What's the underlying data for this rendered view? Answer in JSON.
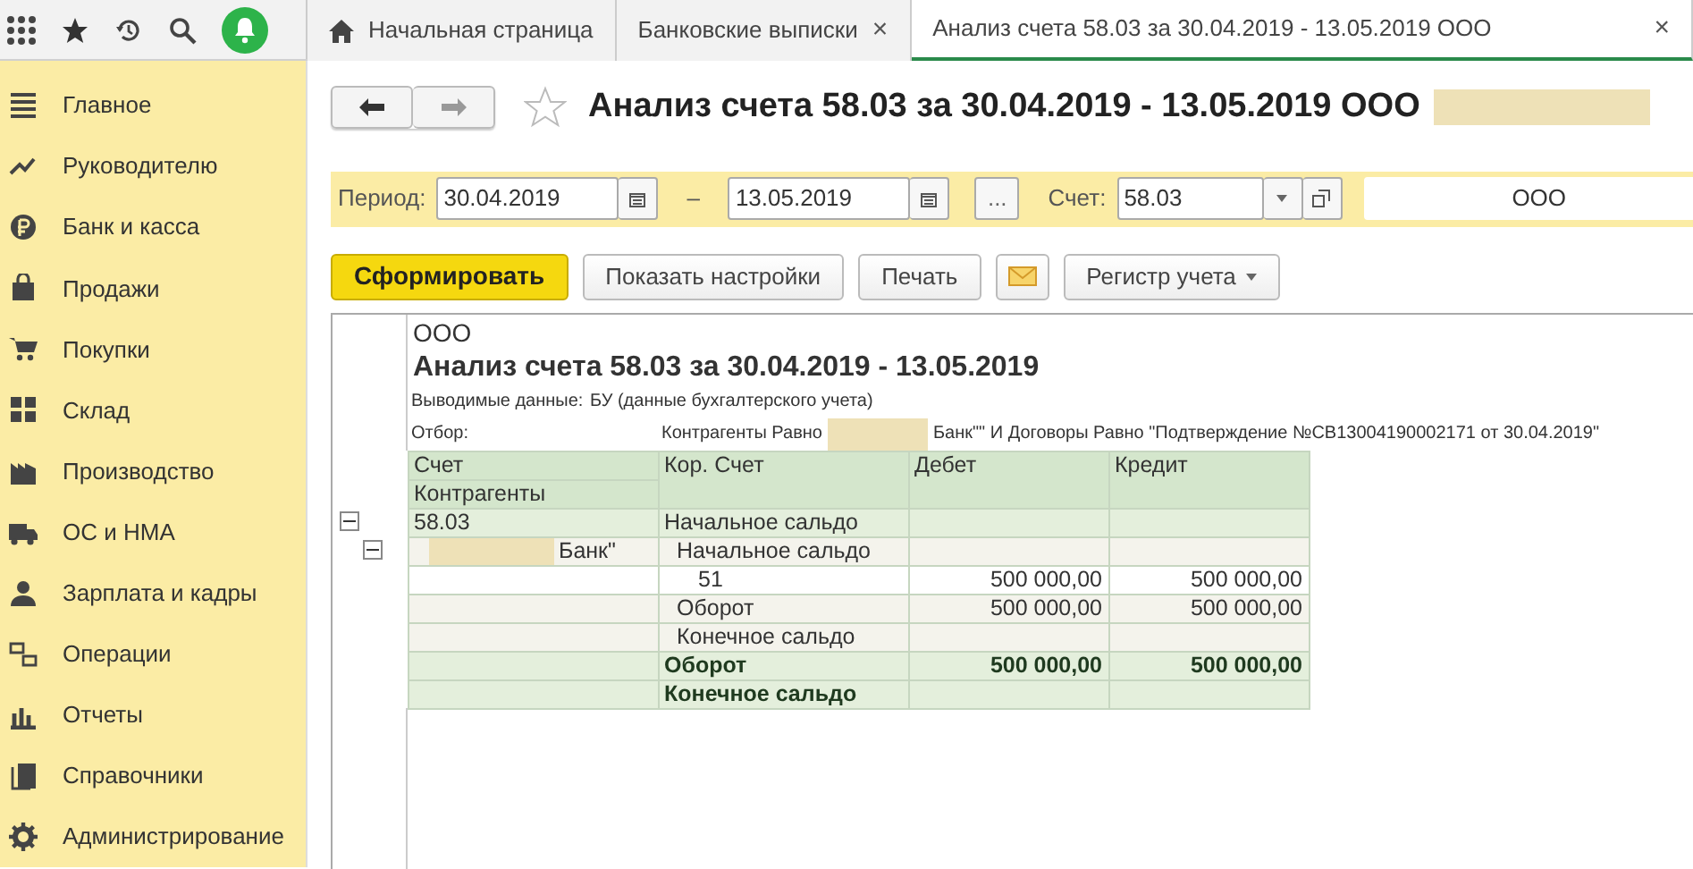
{
  "tabs": [
    {
      "label": "Начальная страница",
      "kind": "home",
      "selected": false
    },
    {
      "label": "Банковские выписки",
      "kind": "closable",
      "selected": false
    },
    {
      "label": "Анализ счета 58.03 за 30.04.2019 - 13.05.2019 ООО",
      "kind": "closable",
      "selected": true
    }
  ],
  "close_glyph": "×",
  "sidebar": {
    "items": [
      {
        "label": "Главное"
      },
      {
        "label": "Руководителю"
      },
      {
        "label": "Банк и касса"
      },
      {
        "label": "Продажи"
      },
      {
        "label": "Покупки"
      },
      {
        "label": "Склад"
      },
      {
        "label": "Производство"
      },
      {
        "label": "ОС и НМА"
      },
      {
        "label": "Зарплата и кадры"
      },
      {
        "label": "Операции"
      },
      {
        "label": "Отчеты"
      },
      {
        "label": "Справочники"
      },
      {
        "label": "Администрирование"
      }
    ]
  },
  "form": {
    "title": "Анализ счета 58.03 за 30.04.2019 - 13.05.2019 ООО",
    "title_redacted": true,
    "favorite": false,
    "period_label": "Период:",
    "date_from": "30.04.2019",
    "dash": "–",
    "date_to": "13.05.2019",
    "more": "...",
    "account_label": "Счет:",
    "account": "58.03",
    "org": "ООО",
    "buttons": [
      {
        "label": "Сформировать",
        "kind": "primary"
      },
      {
        "label": "Показать настройки",
        "kind": "plain"
      },
      {
        "label": "Печать",
        "kind": "plain"
      },
      {
        "kind": "mail"
      },
      {
        "label": "Регистр учета",
        "kind": "dropdown"
      }
    ]
  },
  "report": {
    "org": "ООО",
    "title": "Анализ счета 58.03 за 30.04.2019 - 13.05.2019",
    "params": [
      {
        "name": "Выводимые данные:",
        "value": "БУ (данные бухгалтерского учета)"
      },
      {
        "name": "Отбор:",
        "value": "Контрагенты Равно",
        "redacted": true,
        "value_after": "Банк\"\" И Договоры Равно \"Подтверждение №СВ13004190002171 от 30.04.2019\""
      }
    ],
    "columns": {
      "account": "Счет",
      "counterparty": "Контрагенты",
      "corr": "Кор. Счет",
      "debit": "Дебет",
      "credit": "Кредит"
    },
    "rows": [
      {
        "kind": "group",
        "account": "58.03",
        "corr": "Начальное сальдо",
        "expanded": true,
        "children": [
          {
            "kind": "subgroup",
            "account": "Банк\"",
            "redacted": true,
            "corr": "Начальное сальдо",
            "expanded": true,
            "children": [
              {
                "kind": "detail",
                "corr": "51",
                "debit": "500 000,00",
                "credit": "500 000,00"
              },
              {
                "kind": "sub",
                "corr": "Оборот",
                "debit": "500 000,00",
                "credit": "500 000,00"
              },
              {
                "kind": "sub",
                "corr": "Конечное сальдо"
              }
            ]
          }
        ]
      },
      {
        "kind": "total",
        "corr": "Оборот",
        "debit": "500 000,00",
        "credit": "500 000,00"
      },
      {
        "kind": "total",
        "corr": "Конечное сальдо"
      }
    ]
  }
}
